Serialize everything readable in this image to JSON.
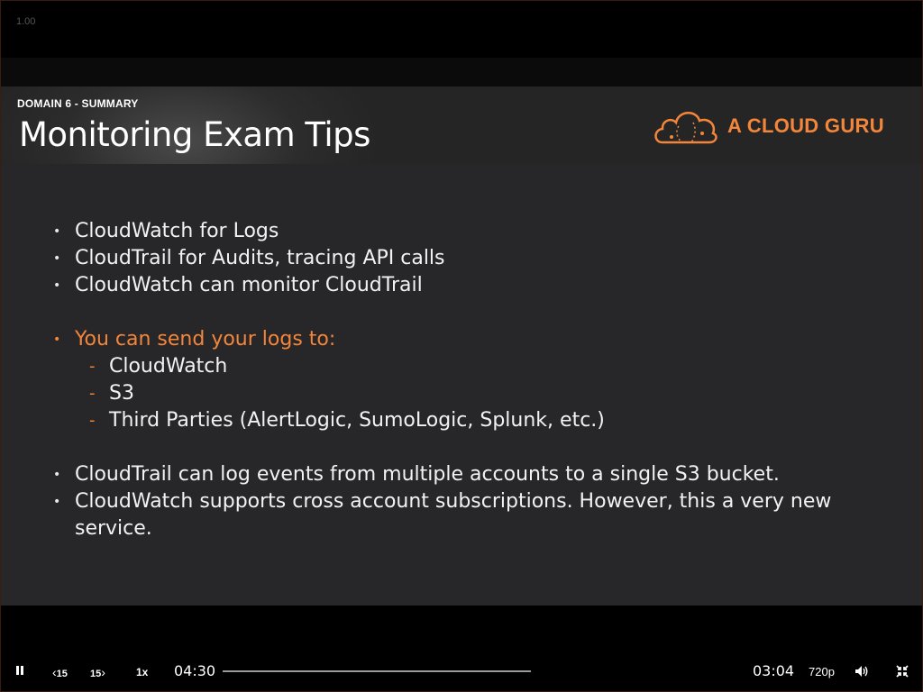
{
  "player": {
    "version_label": "1.00",
    "elapsed_time": "04:30",
    "remaining_time": "03:04",
    "speed_label": "1x",
    "quality_label": "720p",
    "skip_back_label": "15",
    "skip_forward_label": "15",
    "progress_fraction": 0.0
  },
  "slide": {
    "domain_label": "DOMAIN 6 - SUMMARY",
    "title": "Monitoring Exam Tips",
    "brand_name": "A CLOUD GURU",
    "accent_color": "#f4863b",
    "bullets": [
      "CloudWatch for Logs",
      "CloudTrail for Audits, tracing API calls",
      "CloudWatch can monitor CloudTrail",
      "You can send your logs to:",
      "CloudWatch",
      "S3",
      "Third Parties (AlertLogic, SumoLogic, Splunk, etc.)",
      "CloudTrail can log events from multiple accounts to a single S3 bucket.",
      "CloudWatch supports cross account subscriptions. However, this a very new service."
    ]
  },
  "icons": {
    "pause": "pause-icon",
    "skip_back": "skip-back-icon",
    "skip_forward": "skip-forward-icon",
    "volume": "volume-icon",
    "exit_fullscreen": "exit-fullscreen-icon",
    "logo": "cloud-logo-icon"
  }
}
